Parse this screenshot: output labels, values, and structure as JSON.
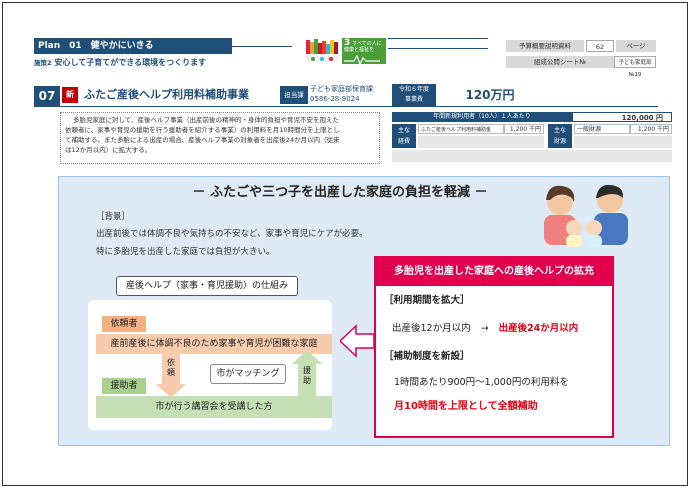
{
  "plan": {
    "label": "Plan　01　健やかにいきる"
  },
  "policy": {
    "tag": "施策2",
    "text": "安心して子育てができる環境をつくります"
  },
  "sdg": {
    "number": "3",
    "caption": "すべての人に健康と福祉を"
  },
  "reference": {
    "doc_label": "予算概要説明資料",
    "page_no": "62",
    "page_unit": "ページ",
    "sheet_label": "組成公開シート№",
    "sheet_value": "子ども家庭部№19"
  },
  "project": {
    "number": "07",
    "badge": "新",
    "title": "ふたご産後ヘルプ利用料補助事業",
    "dept_label": "担当課",
    "dept_name": "子ども家庭部保育課",
    "phone": "0586-28-9024",
    "budget_label_1": "令和６年度",
    "budget_label_2": "事業費",
    "budget_value": "120万円"
  },
  "description": {
    "lines": [
      "多胎児家庭に対して、産後ヘルプ事業（出産前後の精神的・身体的負担や育児不安を抱えた",
      "依頼者に、家事や育児の援助を行う援助者を紹介する事業）の利用料を月10時間分を上限とし",
      "て補助する。また多胎による出産の場合、産後ヘルプ事業の対象者を出産後24か月以内（従来",
      "は12か月以内）に拡大する。"
    ]
  },
  "budget_table": {
    "header_left": "年間新規利用者（10人）１人あたり",
    "header_value": "120,000 円",
    "row1_label_1": "主な",
    "row1_label_2": "経費",
    "row1_item": "ふたご産後ヘルプ利用料補助金",
    "row1_amount": "1,200 千円",
    "row2_label_1": "主な",
    "row2_label_2": "財源",
    "row2_item": "一般財源",
    "row2_amount": "1,200 千円"
  },
  "headline": "－ ふたごや三つ子を出産した家庭の負担を軽減 －",
  "background": {
    "label": "［背景］",
    "line1": "出産前後では体調不良や気持ちの不安など、家事や育児にケアが必要。",
    "line2": "特に多胎児を出産した家庭では負担が大きい。"
  },
  "mechanism": {
    "title": "産後ヘルプ（家事・育児援助）の仕組み",
    "requester_tag": "依頼者",
    "requester_text": "産前産後に体調不良のため家事や育児が困難な家庭",
    "request_text": "依頼",
    "matching": "市がマッチング",
    "helper_tag": "援助者",
    "helper_text": "市が行う講習会を受講した方",
    "assist_text": "援助"
  },
  "expansion": {
    "title": "多胎児を出産した家庭への産後ヘルプの拡充",
    "period_heading": "［利用期間を拡大］",
    "period_before": "出産後12か月以内",
    "arrow": "→",
    "period_after": "出産後24か月以内",
    "subsidy_heading": "［補助制度を新設］",
    "subsidy_line": "1時間あたり900円～1,000円の利用料を",
    "subsidy_highlight": "月10時間を上限として全額補助"
  }
}
